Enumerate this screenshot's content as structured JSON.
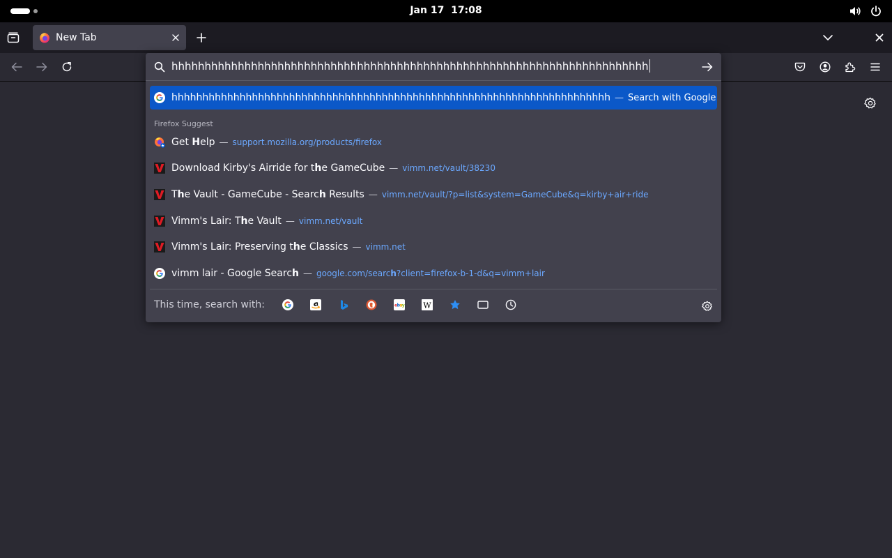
{
  "topbar": {
    "date": "Jan 17",
    "time": "17:08"
  },
  "tabs": [
    {
      "title": "New Tab"
    }
  ],
  "urlbar": {
    "value": "hhhhhhhhhhhhhhhhhhhhhhhhhhhhhhhhhhhhhhhhhhhhhhhhhhhhhhhhhhhhhhhhhhhhhhhh",
    "heuristic": {
      "query": "hhhhhhhhhhhhhhhhhhhhhhhhhhhhhhhhhhhhhhhhhhhhhhhhhhhhhhhhhhhhhhhhhhhhhhh",
      "separator": "—",
      "action": "Search with Google"
    },
    "group_label": "Firefox Suggest",
    "results": [
      {
        "icon": "firefox-help-icon",
        "title_parts": [
          "Get ",
          "H",
          "elp"
        ],
        "url": "support.mozilla.org/products/firefox"
      },
      {
        "icon": "vimm-icon",
        "title_parts": [
          "Download Kirby's Airride for t",
          "h",
          "e GameCube"
        ],
        "url": "vimm.net/vault/38230"
      },
      {
        "icon": "vimm-icon",
        "title_parts": [
          "T",
          "h",
          "e Vault - GameCube - Searc",
          "h",
          " Results"
        ],
        "url": "vimm.net/vault/?p=list&system=GameCube&q=kirby+air+ride"
      },
      {
        "icon": "vimm-icon",
        "title_parts": [
          "Vimm's Lair: T",
          "h",
          "e Vault"
        ],
        "url": "vimm.net/vault"
      },
      {
        "icon": "vimm-icon",
        "title_parts": [
          "Vimm's Lair: Preserving t",
          "h",
          "e Classics"
        ],
        "url": "vimm.net"
      },
      {
        "icon": "google-icon",
        "title_parts": [
          "vimm lair - Google Searc",
          "h"
        ],
        "url_parts": [
          "google.com/searc",
          "h",
          "?client=firefox-b-1-d&q=vimm+lair"
        ]
      }
    ],
    "footer_label": "This time, search with:",
    "engines": [
      "google-icon",
      "amazon-icon",
      "bing-icon",
      "duckduckgo-icon",
      "ebay-icon",
      "wikipedia-icon",
      "bookmarks-star-icon",
      "tabs-icon",
      "history-icon"
    ]
  },
  "colors": {
    "page_bg": "#2b2a33",
    "popup_bg": "#42414d",
    "selected_row": "#0b58c8",
    "url_text": "#6ba8ff"
  }
}
